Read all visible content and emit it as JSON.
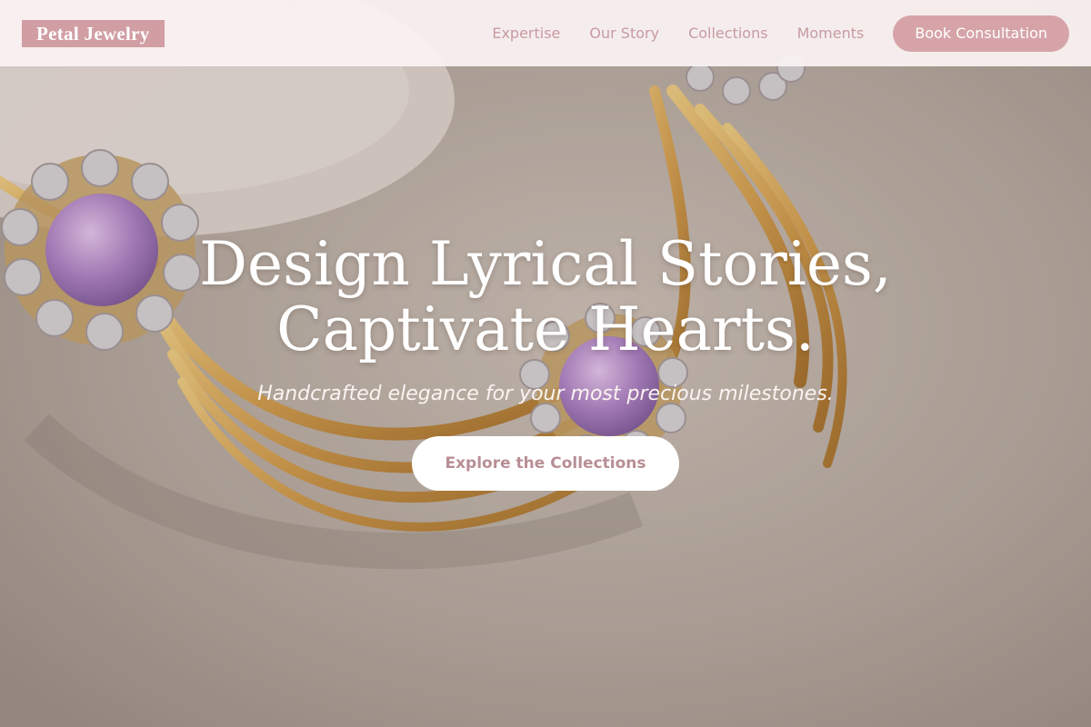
{
  "brand": {
    "name": "Petal Jewelry",
    "accent_color": "#d6a4a8"
  },
  "nav": {
    "links": [
      "Expertise",
      "Our Story",
      "Collections",
      "Moments"
    ],
    "cta_label": "Book Consultation"
  },
  "hero": {
    "title_line1": "Design Lyrical Stories,",
    "title_line2": "Captivate Hearts.",
    "subtitle": "Handcrafted elegance for your most precious milestones.",
    "button_label": "Explore the Collections",
    "background_image": "gold-earrings-with-purple-gems-photo"
  }
}
